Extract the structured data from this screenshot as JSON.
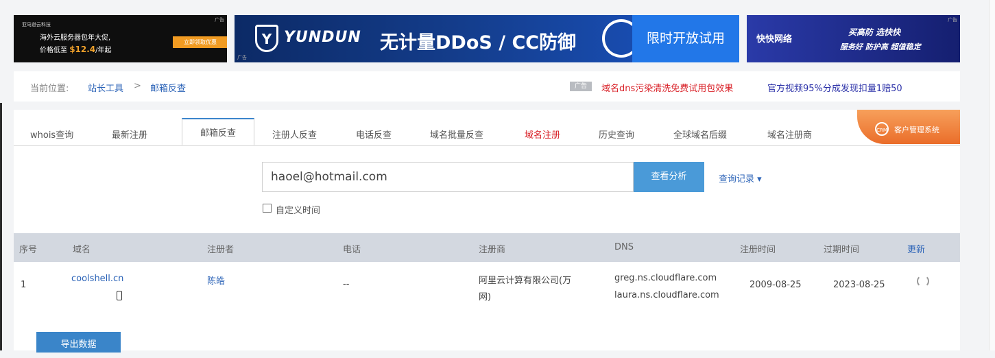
{
  "ads": {
    "ad1": {
      "logo": "亚马逊云科技",
      "line1": "海外云服务器包年大促,",
      "line2_pre": "价格低至 ",
      "line2_price": "$12.4",
      "line2_post": "/年起",
      "button": "立即领取优惠",
      "tag": "广告"
    },
    "ad2": {
      "brand": "YUNDUN",
      "slogan": "无计量DDoS / CC防御",
      "trial": "限时开放试用",
      "tag": "广告"
    },
    "ad3": {
      "brand": "快快网络",
      "right1": "买高防 选快快",
      "right2": "服务好 防护高 超值稳定",
      "tag": "广告"
    }
  },
  "breadcrumb": {
    "label": "当前位置:",
    "item1": "站长工具",
    "sep": ">",
    "item2": "邮箱反查"
  },
  "promo": {
    "badge": "广告",
    "link1": "域名dns污染清洗免费试用包效果",
    "link2": "官方视频95%分成发现扣量1赔50"
  },
  "tabs": [
    "whois查询",
    "最新注册",
    "邮箱反查",
    "注册人反查",
    "电话反查",
    "域名批量反查",
    "域名注册",
    "历史查询",
    "全球域名后缀",
    "域名注册商"
  ],
  "crm": {
    "icon": "CRM",
    "label": "客户管理系统"
  },
  "search": {
    "value": "haoel@hotmail.com",
    "button": "查看分析",
    "history": "查询记录 ▾",
    "checkbox_label": "自定义时间"
  },
  "table": {
    "headers": [
      "序号",
      "域名",
      "注册者",
      "电话",
      "注册商",
      "DNS",
      "注册时间",
      "过期时间",
      "更新"
    ],
    "rows": [
      {
        "index": "1",
        "domain": "coolshell.cn",
        "registrant": "陈皓",
        "phone": "--",
        "registrar_line1": "阿里云计算有限公司(万",
        "registrar_line2": "网)",
        "dns1": "greg.ns.cloudflare.com",
        "dns2": "laura.ns.cloudflare.com",
        "created": "2009-08-25",
        "expires": "2023-08-25"
      }
    ]
  },
  "export_button": "导出数据"
}
